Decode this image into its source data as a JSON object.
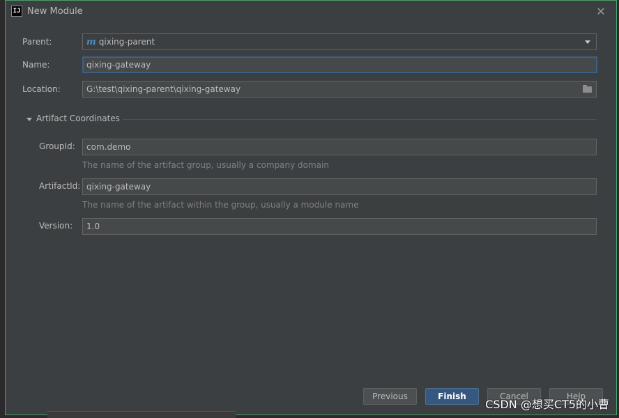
{
  "dialog": {
    "title": "New Module",
    "app_icon_text": "IJ",
    "close_glyph": "✕"
  },
  "form": {
    "parent_label": "Parent:",
    "parent_value": "qixing-parent",
    "parent_icon_glyph": "m",
    "name_label": "Name:",
    "name_value": "qixing-gateway",
    "location_label": "Location:",
    "location_value": "G:\\test\\qixing-parent\\qixing-gateway"
  },
  "artifact": {
    "section_title": "Artifact Coordinates",
    "groupid_label": "GroupId:",
    "groupid_value": "com.demo",
    "groupid_hint": "The name of the artifact group, usually a company domain",
    "artifactid_label": "ArtifactId:",
    "artifactid_value": "qixing-gateway",
    "artifactid_hint": "The name of the artifact within the group, usually a module name",
    "version_label": "Version:",
    "version_value": "1.0"
  },
  "buttons": {
    "previous": "Previous",
    "finish": "Finish",
    "cancel": "Cancel",
    "help": "Help"
  },
  "watermark": "CSDN @想买CT5的小曹",
  "colors": {
    "dialog_bg": "#3c3f41",
    "focus_border": "#3d6185",
    "primary_button": "#365880",
    "maven_icon": "#4a90c2"
  }
}
